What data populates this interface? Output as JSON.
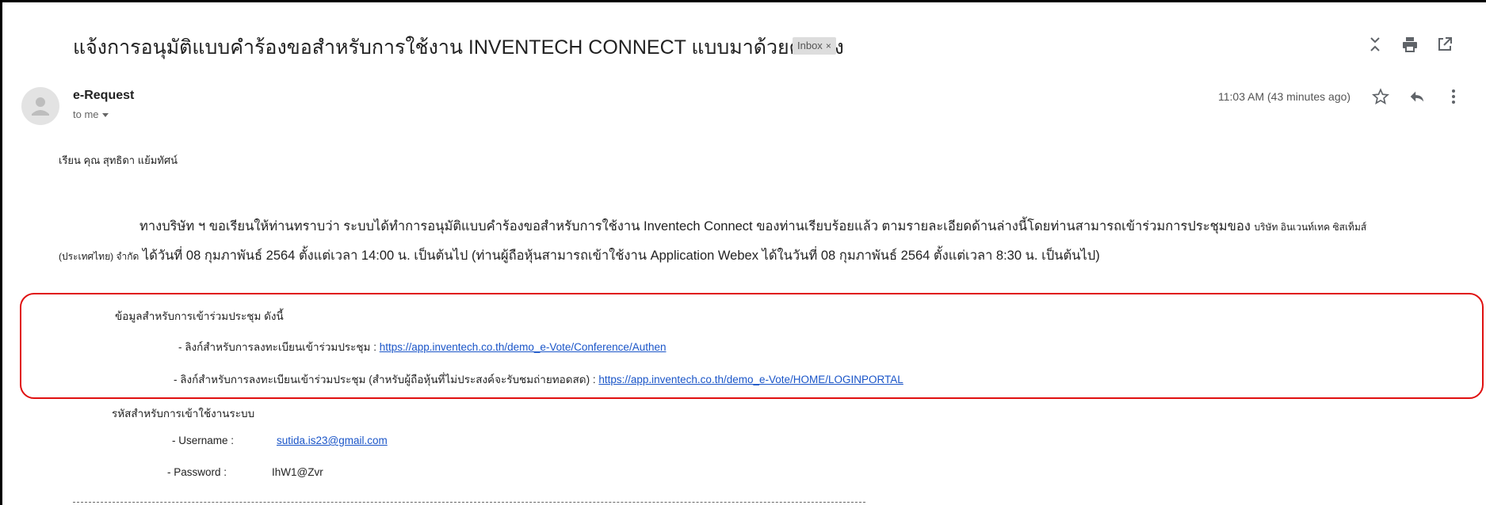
{
  "email": {
    "subject": "แจ้งการอนุมัติแบบคำร้องขอสำหรับการใช้งาน INVENTECH CONNECT แบบมาด้วยตนเอง",
    "label": "Inbox",
    "label_close": "×",
    "sender": "e-Request",
    "recipient": "to me",
    "time": "11:03 AM (43 minutes ago)"
  },
  "icons": {
    "expand": "unfold-icon",
    "print": "print-icon",
    "popout": "open-in-new-icon",
    "star": "star-icon",
    "reply": "reply-icon",
    "more": "more-vert-icon",
    "avatar": "avatar-icon"
  },
  "body": {
    "greeting": "เรียน คุณ สุทธิดา แย้มทัศน์",
    "para_main": "ทางบริษัท ฯ ขอเรียนให้ท่านทราบว่า ระบบได้ทำการอนุมัติแบบคำร้องขอสำหรับการใช้งาน Inventech Connect ของท่านเรียบร้อยแล้ว ตามรายละเอียดด้านล่างนี้โดยท่านสามารถเข้าร่วมการประชุมของ",
    "company_name_1": "บริษัท อินเวนท์เทค ซิสเท็มส์",
    "company_name_2": "(ประเทศไทย) จำกัด",
    "para_rest": "ได้วันที่ 08 กุมภาพันธ์ 2564 ตั้งแต่เวลา 14:00 น. เป็นต้นไป (ท่านผู้ถือหุ้นสามารถเข้าใช้งาน Application Webex ได้ในวันที่ 08 กุมภาพันธ์ 2564 ตั้งแต่เวลา 8:30 น. เป็นต้นไป)",
    "info_title": "ข้อมูลสำหรับการเข้าร่วมประชุม ดังนี้",
    "link1_label": "- ลิงก์สำหรับการลงทะเบียนเข้าร่วมประชุม :",
    "link1_url": "https://app.inventech.co.th/demo_e-Vote/Conference/Authen",
    "link2_label": "- ลิงก์สำหรับการลงทะเบียนเข้าร่วมประชุม (สำหรับผู้ถือหุ้นที่ไม่ประสงค์จะรับชมถ่ายทอดสด) :",
    "link2_url": "https://app.inventech.co.th/demo_e-Vote/HOME/LOGINPORTAL",
    "cred_title": "รหัสสำหรับการเข้าใช้งานระบบ",
    "username_label": "- Username :",
    "username_value": "sutida.is23@gmail.com",
    "password_label": "- Password :",
    "password_value": "IhW1@Zvr"
  },
  "colors": {
    "highlight_box": "#e01010",
    "link": "#1a55c8"
  }
}
